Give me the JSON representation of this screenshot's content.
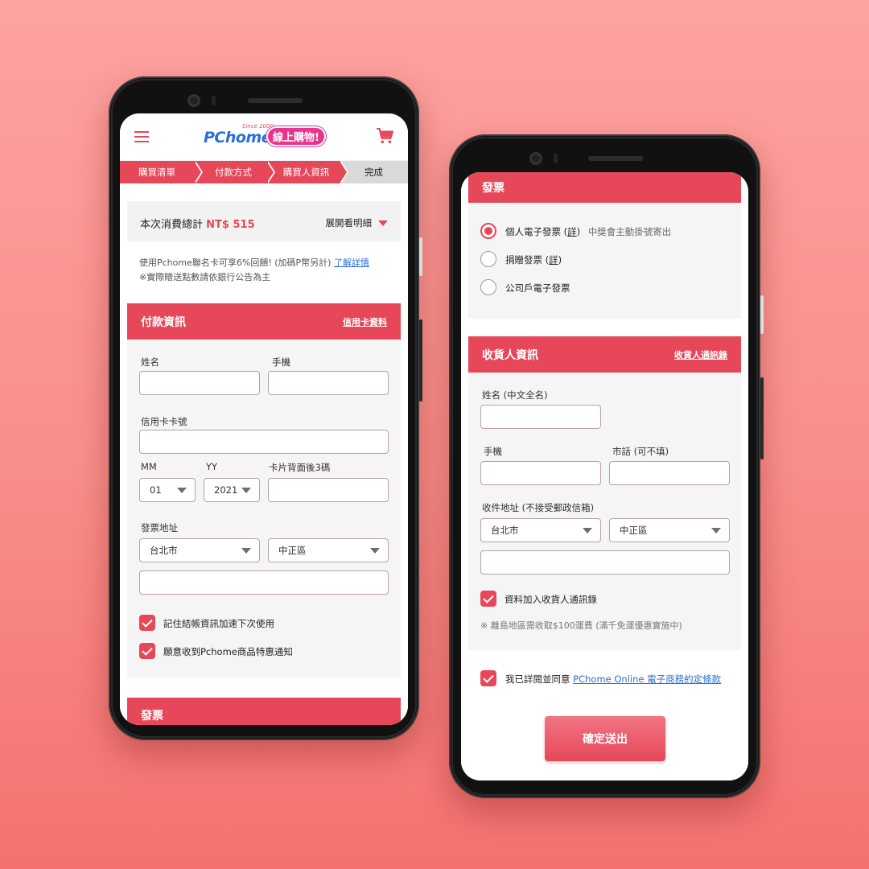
{
  "colors": {
    "accent": "#e6485a",
    "link": "#2b6fd6",
    "background": "#f98d89"
  },
  "phone1": {
    "header": {
      "menu_icon": "hamburger-icon",
      "logo_text": "PChome",
      "logo_since": "Since 2000",
      "logo_badge": "線上購物!",
      "cart_icon": "cart-icon"
    },
    "steps": [
      "購買清單",
      "付款方式",
      "購買人資訊",
      "完成"
    ],
    "total": {
      "label": "本次消費總計",
      "amount": "NT$ 515",
      "expand": "展開看明細"
    },
    "promo": {
      "line1": "使用Pchome聯名卡可享6%回饋! (加碼P幣另計)",
      "link": "了解詳情",
      "line2": "※實際贈送點數請依銀行公告為主"
    },
    "payment": {
      "title": "付款資訊",
      "link": "信用卡資料",
      "name_label": "姓名",
      "phone_label": "手機",
      "card_label": "信用卡卡號",
      "mm_label": "MM",
      "yy_label": "YY",
      "cvv_label": "卡片背面後3碼",
      "mm_value": "01",
      "yy_value": "2021",
      "address_label": "發票地址",
      "city_value": "台北市",
      "district_value": "中正區",
      "remember": "記住結帳資訊加速下次使用",
      "notify": "願意收到Pchome商品特惠通知"
    },
    "next_section": "發票"
  },
  "phone2": {
    "invoice": {
      "title": "發票",
      "options": [
        {
          "label": "個人電子發票 (",
          "detail": "詳",
          "close": ")",
          "note": "中獎會主動掛號寄出",
          "selected": true
        },
        {
          "label": "捐贈發票 (",
          "detail": "詳",
          "close": ")",
          "note": "",
          "selected": false
        },
        {
          "label": "公司戶電子發票",
          "detail": "",
          "close": "",
          "note": "",
          "selected": false
        }
      ]
    },
    "receiver": {
      "title": "收貨人資訊",
      "link": "收貨人通訊錄",
      "name_label": "姓名 (中文全名)",
      "mobile_label": "手機",
      "tel_label": "市話 (可不填)",
      "address_label": "收件地址 (不接受郵政信箱)",
      "city_value": "台北市",
      "district_value": "中正區",
      "save_contact": "資料加入收貨人通訊錄",
      "note": "※ 離島地區需收取$100運費 (滿千免運優惠實施中)"
    },
    "agree": {
      "text": "我已詳閱並同意",
      "link": "PChome Online 電子商務約定條款"
    },
    "submit": "確定送出"
  }
}
